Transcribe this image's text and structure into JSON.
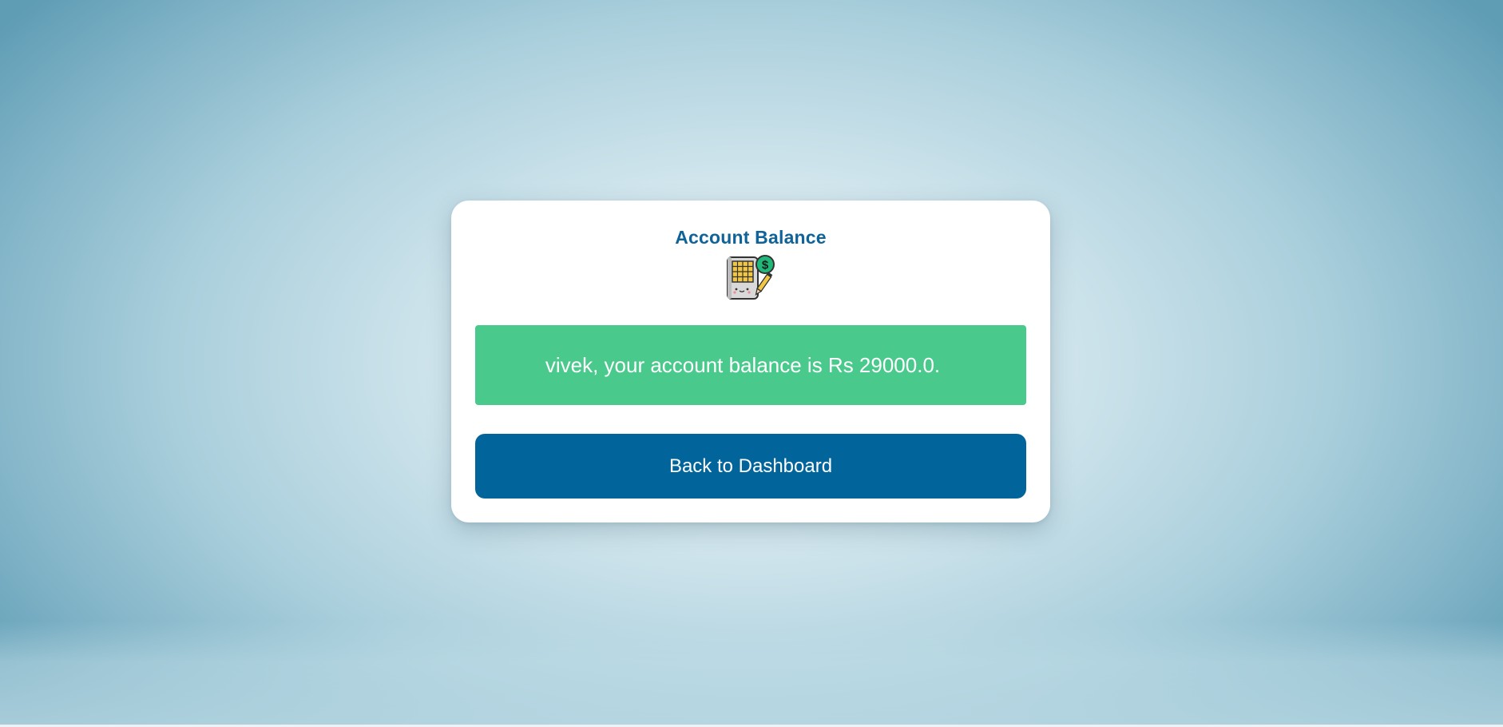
{
  "page": {
    "title": "Account Balance",
    "icon": "calculator-money-icon"
  },
  "balance": {
    "message": "vivek, your account balance is Rs 29000.0."
  },
  "actions": {
    "back_label": "Back to Dashboard"
  },
  "colors": {
    "title": "#0e6398",
    "balance_bg": "#4ac98c",
    "button_bg": "#01659c",
    "card_bg": "#ffffff"
  }
}
